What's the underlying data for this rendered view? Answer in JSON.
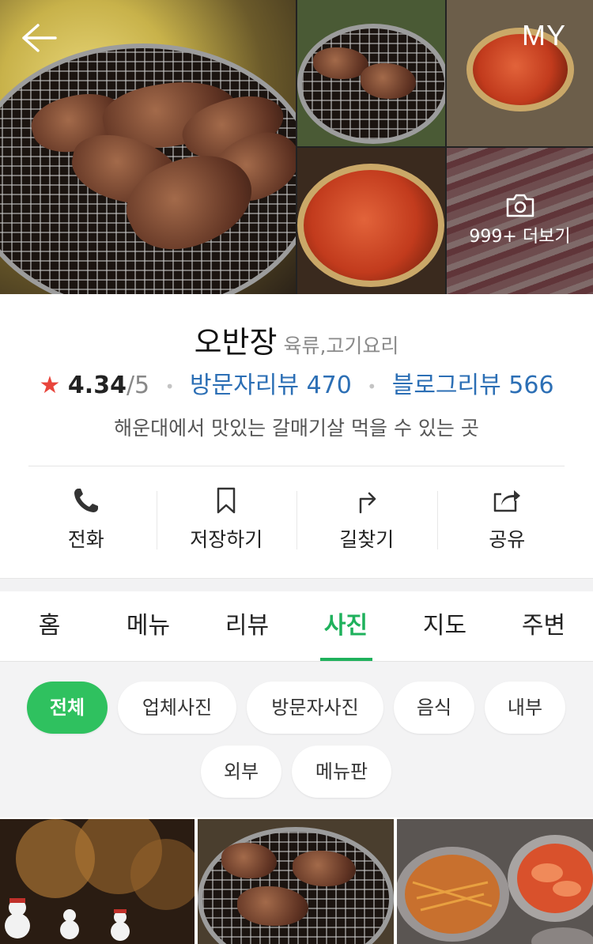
{
  "header": {
    "back_icon": "arrow-left-icon",
    "my_label": "MY",
    "more_photos_label": "999+ 더보기",
    "camera_icon": "camera-icon"
  },
  "place": {
    "name": "오반장",
    "category": "육류,고기요리",
    "rating": "4.34",
    "rating_max": "/5",
    "visitor_reviews": "방문자리뷰 470",
    "blog_reviews": "블로그리뷰 566",
    "description": "해운대에서 맛있는 갈매기살 먹을 수 있는 곳"
  },
  "actions": [
    {
      "label": "전화",
      "icon": "phone-icon"
    },
    {
      "label": "저장하기",
      "icon": "bookmark-icon"
    },
    {
      "label": "길찾기",
      "icon": "directions-icon"
    },
    {
      "label": "공유",
      "icon": "share-icon"
    }
  ],
  "tabs": [
    "홈",
    "메뉴",
    "리뷰",
    "사진",
    "지도",
    "주변"
  ],
  "active_tab": "사진",
  "filters": [
    "전체",
    "업체사진",
    "방문자사진",
    "음식",
    "내부",
    "외부",
    "메뉴판"
  ],
  "active_filter": "전체",
  "colors": {
    "accent_green": "#1fb15c",
    "chip_active": "#2fc15f",
    "link_blue": "#2c6fb5",
    "star_red": "#e8453c"
  }
}
